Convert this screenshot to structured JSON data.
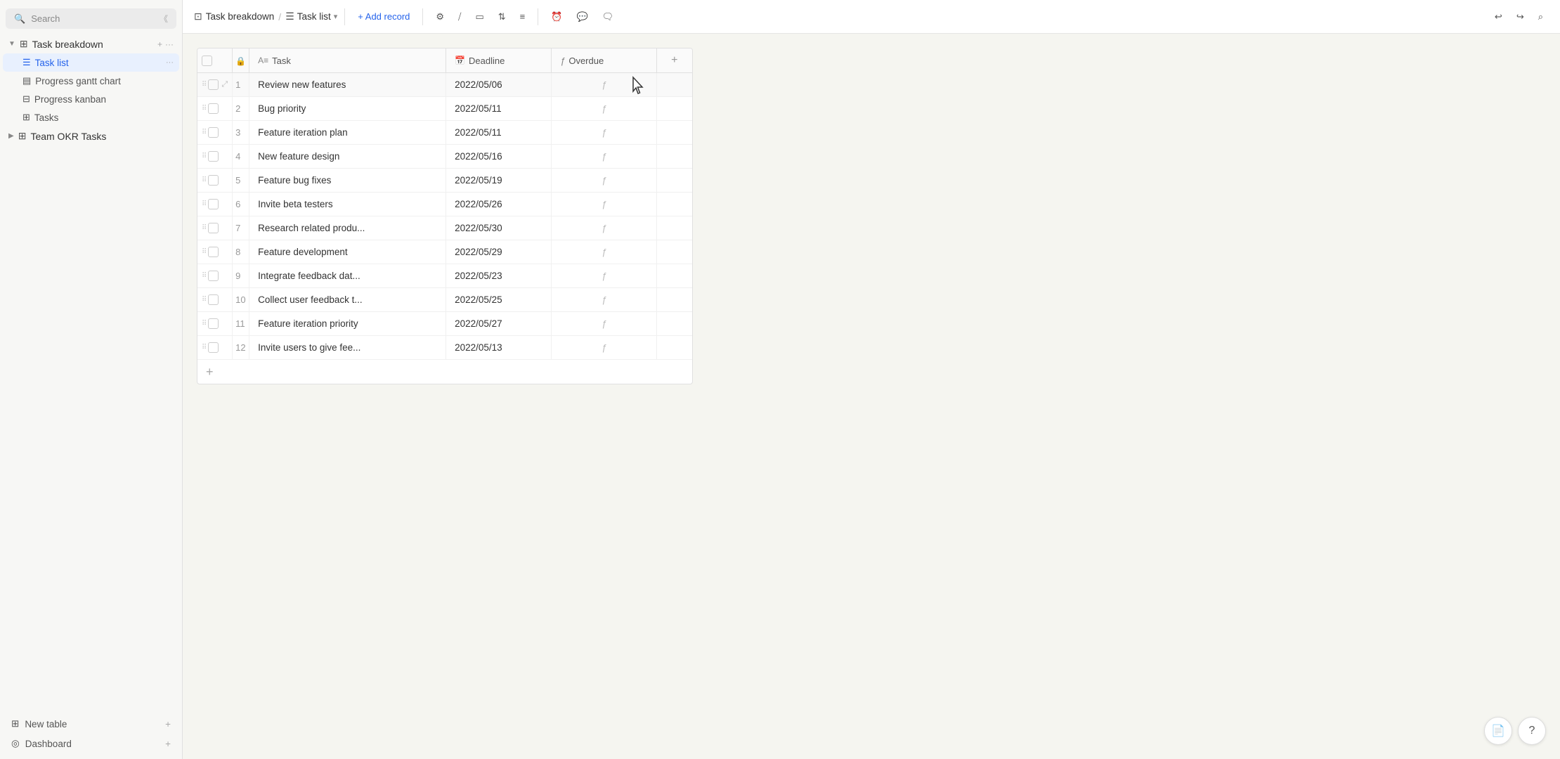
{
  "sidebar": {
    "search_placeholder": "Search",
    "collapse_tooltip": "Collapse sidebar",
    "groups": [
      {
        "id": "task-breakdown",
        "label": "Task breakdown",
        "icon": "grid-icon",
        "expanded": true,
        "add_btn": "+",
        "more_btn": "...",
        "items": [
          {
            "id": "task-list",
            "label": "Task list",
            "icon": "list-icon",
            "active": true,
            "more": "..."
          },
          {
            "id": "progress-gantt",
            "label": "Progress gantt chart",
            "icon": "gantt-icon",
            "active": false
          },
          {
            "id": "progress-kanban",
            "label": "Progress kanban",
            "icon": "kanban-icon",
            "active": false
          },
          {
            "id": "tasks",
            "label": "Tasks",
            "icon": "grid-icon",
            "active": false
          }
        ]
      },
      {
        "id": "team-okr",
        "label": "Team OKR Tasks",
        "icon": "grid-icon",
        "expanded": false,
        "items": []
      }
    ],
    "bottom_items": [
      {
        "id": "new-table",
        "label": "New table",
        "icon": "grid-icon",
        "has_plus": true
      },
      {
        "id": "dashboard",
        "label": "Dashboard",
        "icon": "circle-icon",
        "has_plus": true
      }
    ]
  },
  "topbar": {
    "breadcrumb": [
      {
        "id": "task-breakdown",
        "label": "Task breakdown",
        "icon": "table-icon"
      },
      {
        "id": "task-list",
        "label": "Task list",
        "icon": "list-icon",
        "dropdown": true
      }
    ],
    "add_record_label": "+ Add record",
    "toolbar_icons": [
      "settings",
      "filter",
      "group",
      "sort",
      "fields",
      "reminder",
      "comment2",
      "message"
    ],
    "undo_icon": "undo",
    "redo_icon": "redo",
    "search_icon": "search"
  },
  "table": {
    "columns": [
      {
        "id": "check",
        "label": ""
      },
      {
        "id": "lock",
        "label": ""
      },
      {
        "id": "task",
        "label": "Task",
        "type": "text-icon"
      },
      {
        "id": "deadline",
        "label": "Deadline",
        "type": "calendar-icon"
      },
      {
        "id": "overdue",
        "label": "Overdue",
        "type": "formula-icon"
      },
      {
        "id": "add",
        "label": "+"
      }
    ],
    "rows": [
      {
        "num": 1,
        "task": "Review new features",
        "deadline": "2022/05/06",
        "overdue": "ƒ",
        "hovered": true
      },
      {
        "num": 2,
        "task": "Bug priority",
        "deadline": "2022/05/11",
        "overdue": "ƒ"
      },
      {
        "num": 3,
        "task": "Feature iteration plan",
        "deadline": "2022/05/11",
        "overdue": "ƒ"
      },
      {
        "num": 4,
        "task": "New feature design",
        "deadline": "2022/05/16",
        "overdue": "ƒ"
      },
      {
        "num": 5,
        "task": "Feature bug fixes",
        "deadline": "2022/05/19",
        "overdue": "ƒ"
      },
      {
        "num": 6,
        "task": "Invite beta testers",
        "deadline": "2022/05/26",
        "overdue": "ƒ"
      },
      {
        "num": 7,
        "task": "Research related produ...",
        "deadline": "2022/05/30",
        "overdue": "ƒ"
      },
      {
        "num": 8,
        "task": "Feature development",
        "deadline": "2022/05/29",
        "overdue": "ƒ"
      },
      {
        "num": 9,
        "task": "Integrate feedback dat...",
        "deadline": "2022/05/23",
        "overdue": "ƒ"
      },
      {
        "num": 10,
        "task": "Collect user feedback t...",
        "deadline": "2022/05/25",
        "overdue": "ƒ"
      },
      {
        "num": 11,
        "task": "Feature iteration priority",
        "deadline": "2022/05/27",
        "overdue": "ƒ"
      },
      {
        "num": 12,
        "task": "Invite users to give fee...",
        "deadline": "2022/05/13",
        "overdue": "ƒ"
      }
    ],
    "add_row_label": "+"
  },
  "bottom_right": {
    "doc_btn_icon": "document",
    "help_btn_icon": "question"
  }
}
